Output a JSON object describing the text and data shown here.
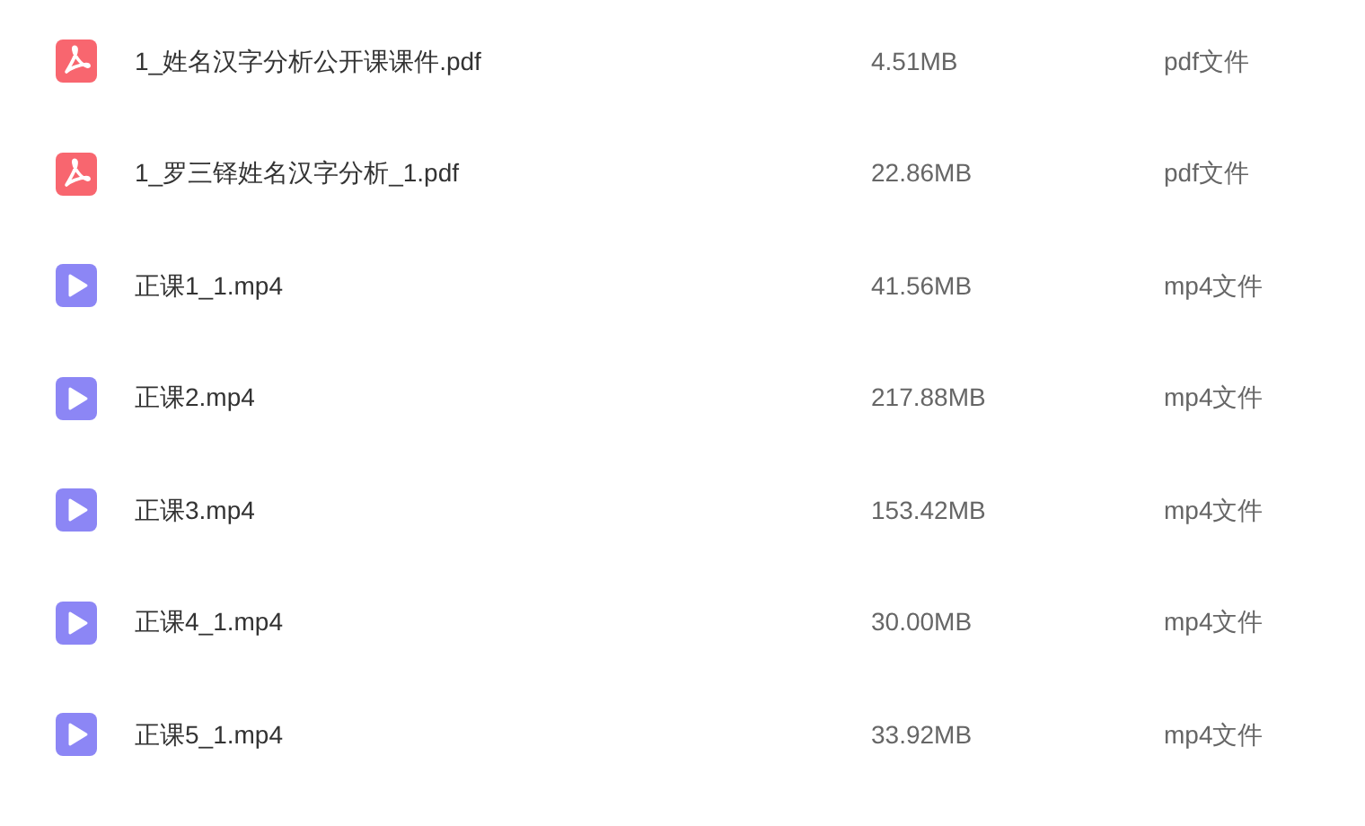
{
  "files": [
    {
      "kind": "pdf",
      "name": "1_姓名汉字分析公开课课件.pdf",
      "size": "4.51MB",
      "type": "pdf文件"
    },
    {
      "kind": "pdf",
      "name": "1_罗三铎姓名汉字分析_1.pdf",
      "size": "22.86MB",
      "type": "pdf文件"
    },
    {
      "kind": "video",
      "name": "正课1_1.mp4",
      "size": "41.56MB",
      "type": "mp4文件"
    },
    {
      "kind": "video",
      "name": "正课2.mp4",
      "size": "217.88MB",
      "type": "mp4文件"
    },
    {
      "kind": "video",
      "name": "正课3.mp4",
      "size": "153.42MB",
      "type": "mp4文件"
    },
    {
      "kind": "video",
      "name": "正课4_1.mp4",
      "size": "30.00MB",
      "type": "mp4文件"
    },
    {
      "kind": "video",
      "name": "正课5_1.mp4",
      "size": "33.92MB",
      "type": "mp4文件"
    }
  ]
}
